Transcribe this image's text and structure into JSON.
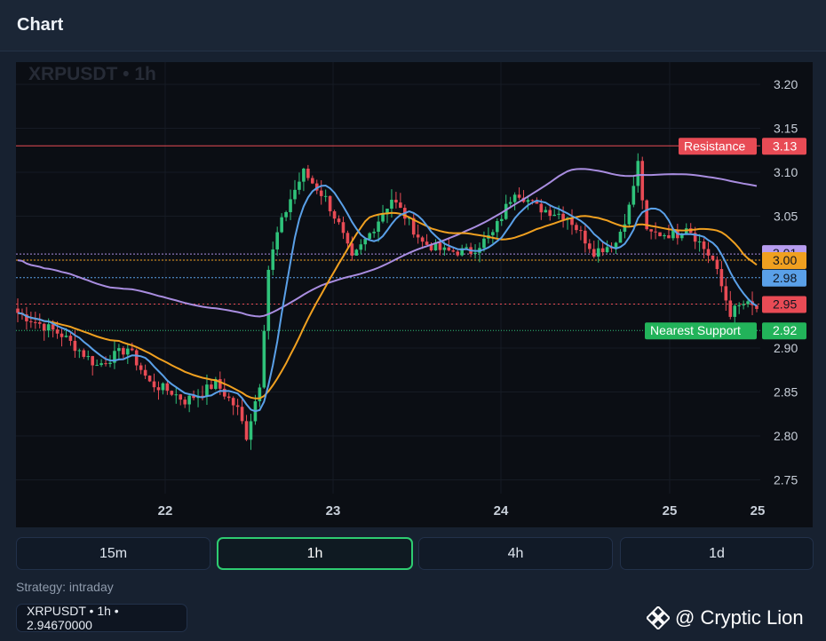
{
  "header": {
    "title": "Chart"
  },
  "chart": {
    "watermark": "XRPUSDT • 1h",
    "price_axis": [
      "3.20",
      "3.15",
      "3.10",
      "3.05",
      "3.00",
      "2.95",
      "2.90",
      "2.85",
      "2.80",
      "2.75"
    ],
    "time_axis": [
      "22",
      "23",
      "24",
      "25",
      "25"
    ],
    "levels": [
      {
        "label": "Resistance",
        "value": "3.13",
        "color": "#e84b55"
      },
      {
        "label": "Nearest Support",
        "value": "2.92",
        "color": "#22b35a"
      }
    ],
    "price_tags": [
      {
        "value": "3.01",
        "color": "#b79cf0"
      },
      {
        "value": "3.00",
        "color": "#f0a020"
      },
      {
        "value": "2.98",
        "color": "#5aa0e8"
      },
      {
        "value": "2.95",
        "color": "#e84b55"
      }
    ],
    "colors": {
      "up": "#2fc27a",
      "down": "#e84b55",
      "ma_fast": "#5aa0e8",
      "ma_mid": "#f0a020",
      "ma_slow": "#a98de0"
    }
  },
  "timeframes": [
    {
      "label": "15m",
      "active": false
    },
    {
      "label": "1h",
      "active": true
    },
    {
      "label": "4h",
      "active": false
    },
    {
      "label": "1d",
      "active": false
    }
  ],
  "strategy": {
    "text": "Strategy: intraday"
  },
  "ticker": {
    "text": "XRPUSDT • 1h • 2.94670000"
  },
  "brand": {
    "text": "@ Cryptic Lion"
  }
}
